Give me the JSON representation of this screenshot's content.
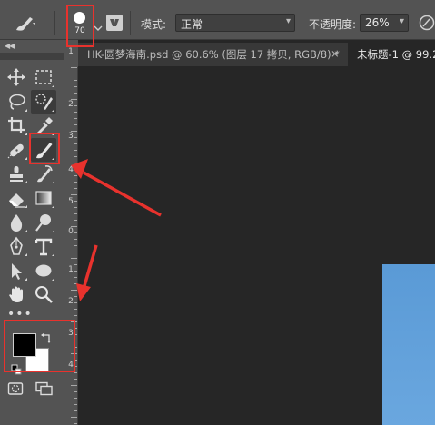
{
  "options_bar": {
    "brush_size": "70",
    "mode_label": "模式:",
    "mode_value": "正常",
    "opacity_label": "不透明度:",
    "opacity_value": "26%"
  },
  "tabs": [
    {
      "label": "HK-圆梦海南.psd @ 60.6% (图层 17 拷贝, RGB/8) *",
      "close": "×",
      "active": false
    },
    {
      "label": "未标题-1 @ 99.2",
      "active": true
    }
  ],
  "ruler": {
    "labels": [
      "1",
      "2",
      "3",
      "4",
      "5",
      "0",
      "1",
      "2",
      "3",
      "4"
    ]
  },
  "toolbar": {
    "more_tools": "•••",
    "tools": [
      {
        "name": "move-tool-icon"
      },
      {
        "name": "marquee-tool-icon"
      },
      {
        "name": "lasso-tool-icon"
      },
      {
        "name": "quick-selection-tool-icon"
      },
      {
        "name": "crop-tool-icon"
      },
      {
        "name": "eyedropper-tool-icon"
      },
      {
        "name": "healing-brush-tool-icon"
      },
      {
        "name": "brush-tool-icon"
      },
      {
        "name": "clone-stamp-tool-icon"
      },
      {
        "name": "history-brush-tool-icon"
      },
      {
        "name": "eraser-tool-icon"
      },
      {
        "name": "gradient-tool-icon"
      },
      {
        "name": "blur-tool-icon"
      },
      {
        "name": "dodge-tool-icon"
      },
      {
        "name": "pen-tool-icon"
      },
      {
        "name": "type-tool-icon"
      },
      {
        "name": "path-selection-tool-icon"
      },
      {
        "name": "ellipse-tool-icon"
      },
      {
        "name": "hand-tool-icon"
      },
      {
        "name": "zoom-tool-icon"
      }
    ],
    "foreground_color": "#000000",
    "background_color": "#ffffff"
  },
  "colors": {
    "annotation": "#e8322d",
    "panel": "#535353",
    "canvas": "#262626",
    "document": "#5a9ad6"
  }
}
